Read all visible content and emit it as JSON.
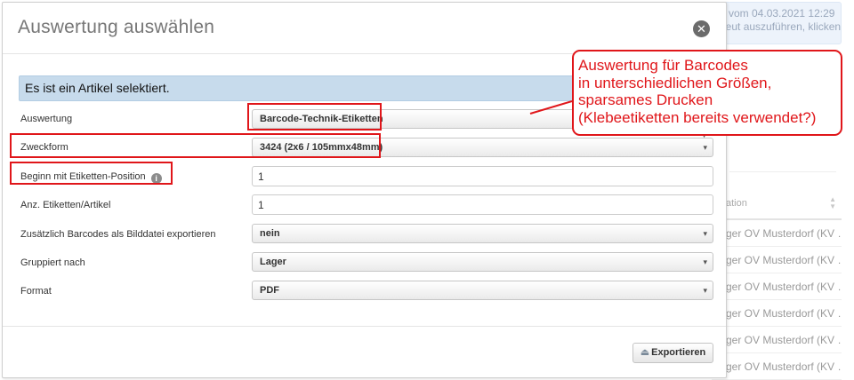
{
  "background": {
    "alert_lines": [
      "e vom 04.03.2021 12:29",
      "neut auszuführen, klicken"
    ],
    "table_header": "ation",
    "row_text": "ger OV Musterdorf (KV …",
    "row_count": 6
  },
  "modal": {
    "title": "Auswertung auswählen",
    "close_symbol": "✕",
    "info_banner": "Es ist ein Artikel selektiert.",
    "fields": {
      "auswertung": {
        "label": "Auswertung",
        "value": "Barcode-Technik-Etiketten"
      },
      "zweckform": {
        "label": "Zweckform",
        "value": "3424 (2x6 / 105mmx48mm)"
      },
      "beginn": {
        "label": "Beginn mit Etiketten-Position",
        "value": "1"
      },
      "anzahl": {
        "label": "Anz. Etiketten/Artikel",
        "value": "1"
      },
      "bilddatei": {
        "label": "Zusätzlich Barcodes als Bilddatei exportieren",
        "value": "nein"
      },
      "gruppiert": {
        "label": "Gruppiert nach",
        "value": "Lager"
      },
      "format": {
        "label": "Format",
        "value": "PDF"
      }
    },
    "export_label": "Exportieren",
    "icons": {
      "close": "close-icon",
      "info": "info-icon",
      "export": "export-icon",
      "caret": "chevron-down-icon"
    }
  },
  "annotation": {
    "callout_lines": [
      "Auswertung für Barcodes",
      "in unterschiedlichen Größen,",
      "sparsames Drucken",
      "(Klebeetiketten bereits verwendet?)"
    ],
    "color": "#e0161a"
  }
}
